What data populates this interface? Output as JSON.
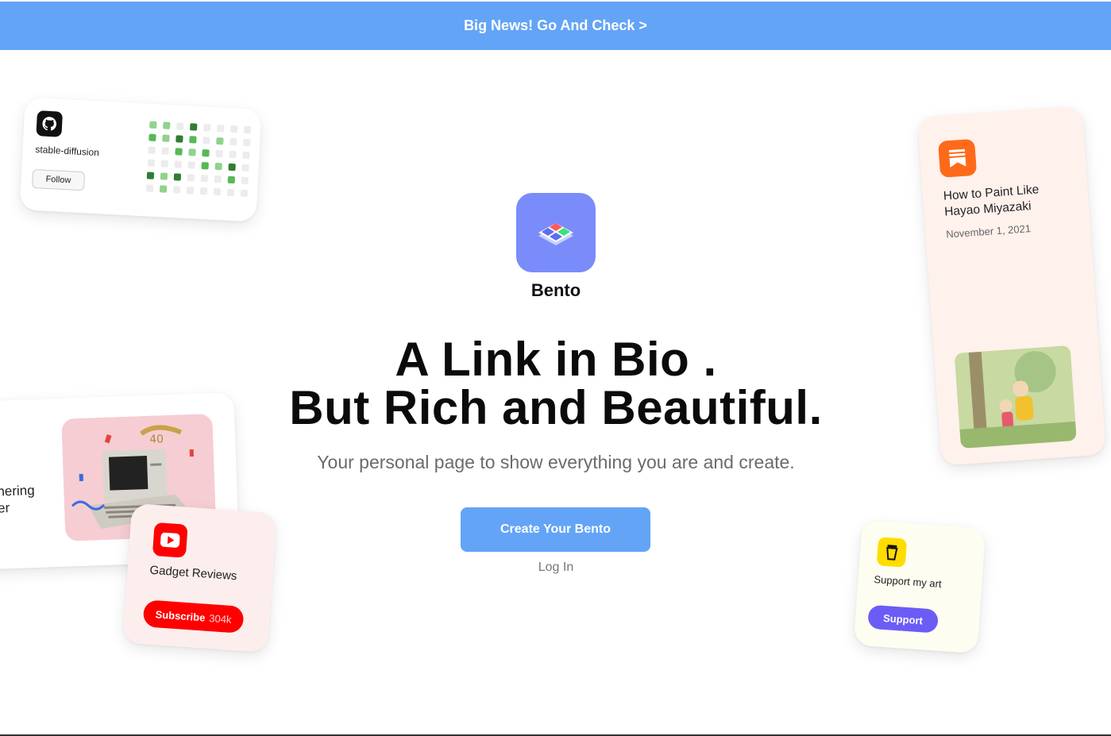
{
  "banner": {
    "text": "Big News! Go And Check >"
  },
  "brand": {
    "name": "Bento",
    "logo_icon": "bento-logo-icon",
    "logo_color": "#7a8cfa"
  },
  "hero": {
    "headline_line1": "A Link in Bio .",
    "headline_line2": "But Rich and Beautiful.",
    "subline": "Your personal page to show everything you are and create.",
    "cta_label": "Create Your Bento",
    "login_label": "Log In"
  },
  "cards": {
    "github": {
      "icon": "github-icon",
      "repo_name": "stable-diffusion",
      "follow_label": "Follow"
    },
    "mid": {
      "line1": "nering",
      "line2": "er"
    },
    "youtube": {
      "icon": "youtube-icon",
      "title": "Gadget Reviews",
      "subscribe_label": "Subscribe",
      "subscriber_count": "304k"
    },
    "blog": {
      "icon": "substack-icon",
      "title": "How to Paint Like Hayao Miyazaki",
      "date": "November 1, 2021"
    },
    "support": {
      "icon": "coffee-cup-icon",
      "text": "Support my art",
      "button_label": "Support"
    }
  },
  "colors": {
    "accent": "#63a4f7",
    "youtube_red": "#ff0000",
    "blog_orange": "#ff6a1a",
    "support_purple": "#6b5cf6"
  }
}
